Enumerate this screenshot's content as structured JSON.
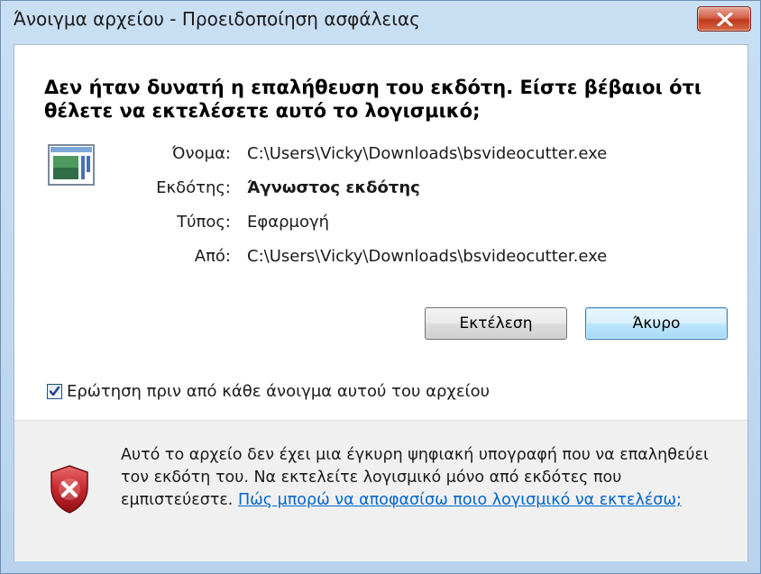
{
  "window": {
    "title": "Άνοιγμα αρχείου - Προειδοποίηση ασφάλειας"
  },
  "dialog": {
    "heading": "Δεν ήταν δυνατή η επαλήθευση του εκδότη. Είστε βέβαιοι ότι θέλετε να εκτελέσετε αυτό το λογισμικό;",
    "fields": {
      "name_label": "Όνομα:",
      "name_value": "C:\\Users\\Vicky\\Downloads\\bsvideocutter.exe",
      "publisher_label": "Εκδότης:",
      "publisher_value": "Άγνωστος εκδότης",
      "type_label": "Τύπος:",
      "type_value": "Εφαρμογή",
      "from_label": "Από:",
      "from_value": "C:\\Users\\Vicky\\Downloads\\bsvideocutter.exe"
    },
    "buttons": {
      "run": "Εκτέλεση",
      "cancel": "Άκυρο"
    },
    "checkbox": {
      "label": "Ερώτηση πριν από κάθε άνοιγμα αυτού του αρχείου",
      "checked": true
    },
    "footer": {
      "text": "Αυτό το αρχείο δεν έχει μια έγκυρη ψηφιακή υπογραφή που να επαληθεύει τον εκδότη του. Να εκτελείτε λογισμικό μόνο από εκδότες που εμπιστεύεστε. ",
      "link": "Πώς μπορώ να αποφασίσω ποιο λογισμικό να εκτελέσω;"
    }
  },
  "icons": {
    "close": "close-icon",
    "file": "application-file-icon",
    "warning": "security-shield-error-icon",
    "checkmark": "checkmark-icon"
  },
  "colors": {
    "title_bar": "#c9dff3",
    "close_button": "#c0391f",
    "link": "#0066cc",
    "shield": "#c8262c"
  }
}
